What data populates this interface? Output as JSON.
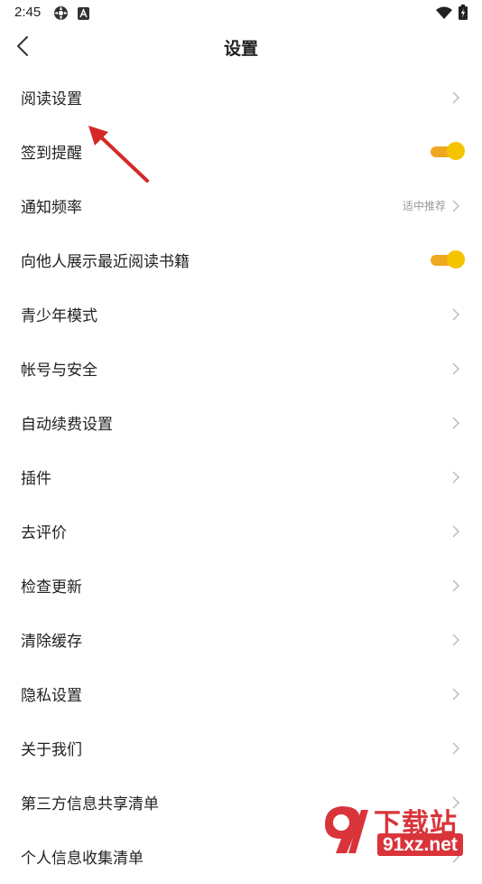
{
  "status_bar": {
    "time": "2:45",
    "icons": [
      "settings-gear-icon",
      "notification-a-icon",
      "wifi-icon",
      "battery-charging-icon"
    ]
  },
  "header": {
    "title": "设置",
    "back_icon": "chevron-left-icon"
  },
  "settings": [
    {
      "label": "阅读设置",
      "type": "nav"
    },
    {
      "label": "签到提醒",
      "type": "toggle",
      "on": true
    },
    {
      "label": "通知频率",
      "type": "nav",
      "value": "适中推荐"
    },
    {
      "label": "向他人展示最近阅读书籍",
      "type": "toggle",
      "on": true
    },
    {
      "label": "青少年模式",
      "type": "nav"
    },
    {
      "label": "帐号与安全",
      "type": "nav"
    },
    {
      "label": "自动续费设置",
      "type": "nav"
    },
    {
      "label": "插件",
      "type": "nav"
    },
    {
      "label": "去评价",
      "type": "nav"
    },
    {
      "label": "检查更新",
      "type": "nav"
    },
    {
      "label": "清除缓存",
      "type": "nav"
    },
    {
      "label": "隐私设置",
      "type": "nav"
    },
    {
      "label": "关于我们",
      "type": "nav"
    },
    {
      "label": "第三方信息共享清单",
      "type": "nav"
    },
    {
      "label": "个人信息收集清单",
      "type": "nav"
    }
  ],
  "colors": {
    "toggle_knob": "#f5c400",
    "toggle_track": "#f0a820",
    "chevron": "#bbbbbb",
    "annotation_arrow": "#d62828",
    "watermark": "#d9343a"
  },
  "watermark": {
    "brand": "下载站",
    "domain": "91xz.net"
  }
}
